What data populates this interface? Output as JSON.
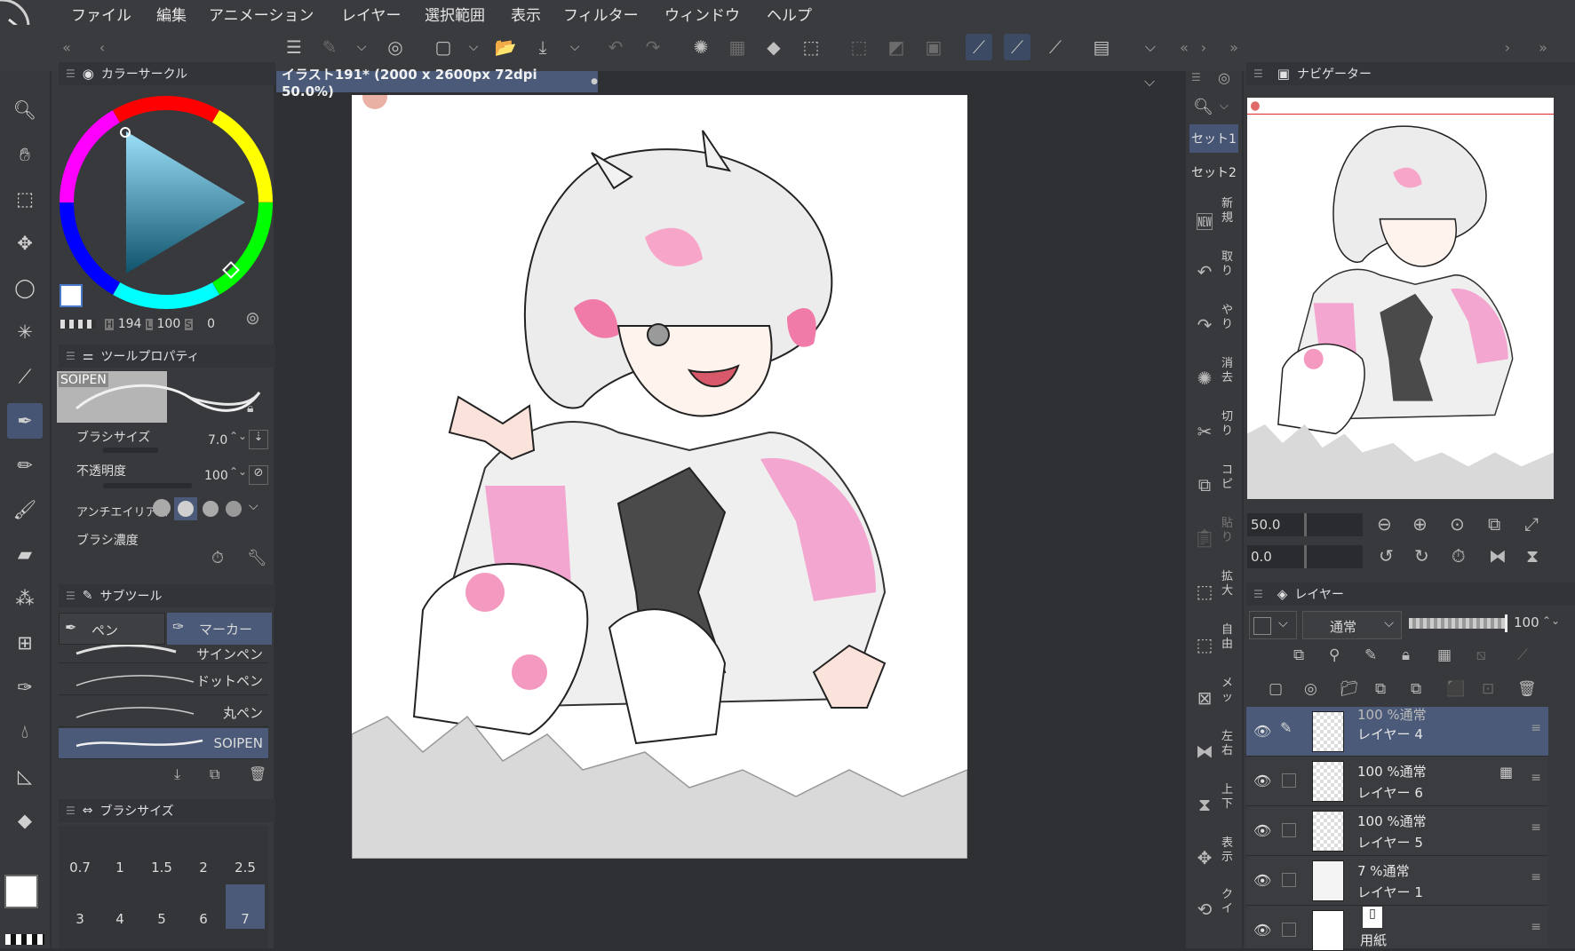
{
  "menu": [
    "ファイル",
    "編集",
    "アニメーション",
    "レイヤー",
    "選択範囲",
    "表示",
    "フィルター",
    "ウィンドウ",
    "ヘルプ"
  ],
  "color_circle": {
    "title": "カラーサークル",
    "h_label": "H",
    "h": "194",
    "l_label": "L",
    "l": "100",
    "s_label": "S",
    "s": "0"
  },
  "tool_property": {
    "title": "ツールプロパティ",
    "brush_name": "SOIPEN",
    "brush_size_label": "ブラシサイズ",
    "brush_size": "7.0",
    "opacity_label": "不透明度",
    "opacity": "100",
    "antialias_label": "アンチエイリアス",
    "density_label": "ブラシ濃度"
  },
  "subtool": {
    "title": "サブツール",
    "tabs": [
      "ペン",
      "マーカー"
    ],
    "active_tab": "マーカー",
    "items": [
      "サインペン",
      "ドットペン",
      "丸ペン",
      "SOIPEN"
    ],
    "selected": "SOIPEN"
  },
  "brush_size_panel": {
    "title": "ブラシサイズ",
    "sizes_row1": [
      "0.7",
      "1",
      "1.5",
      "2",
      "2.5"
    ],
    "sizes_row2": [
      "3",
      "4",
      "5",
      "6",
      "7"
    ],
    "selected": "7"
  },
  "document": {
    "tab_title": "イラスト191* (2000 x 2600px 72dpi 50.0%)"
  },
  "sets": [
    "セット1",
    "セット2"
  ],
  "quick_access": [
    {
      "icon": "new-icon",
      "label": "新規"
    },
    {
      "icon": "undo-icon",
      "label": "取り"
    },
    {
      "icon": "redo-icon",
      "label": "やり"
    },
    {
      "icon": "clear-icon",
      "label": "消去"
    },
    {
      "icon": "cut-icon",
      "label": "切り"
    },
    {
      "icon": "copy-icon",
      "label": "コピ"
    },
    {
      "icon": "paste-icon",
      "label": "貼り"
    },
    {
      "icon": "scale-icon",
      "label": "拡大"
    },
    {
      "icon": "free-transform-icon",
      "label": "自由"
    },
    {
      "icon": "mesh-icon",
      "label": "メッ"
    },
    {
      "icon": "flip-h-icon",
      "label": "左右"
    },
    {
      "icon": "flip-v-icon",
      "label": "上下"
    },
    {
      "icon": "show-icon",
      "label": "表示"
    },
    {
      "icon": "quick-icon",
      "label": "クイ"
    }
  ],
  "navigator": {
    "title": "ナビゲーター",
    "zoom": "50.0",
    "rotate": "0.0"
  },
  "layers_panel": {
    "title": "レイヤー",
    "blend_mode": "通常",
    "opacity": "100",
    "layers": [
      {
        "mode": "100 %通常",
        "name": "レイヤー 4",
        "selected": true
      },
      {
        "mode": "100 %通常",
        "name": "レイヤー 6",
        "selected": false
      },
      {
        "mode": "100 %通常",
        "name": "レイヤー 5",
        "selected": false
      },
      {
        "mode": "7 %通常",
        "name": "レイヤー 1",
        "selected": false
      },
      {
        "mode": "",
        "name": "用紙",
        "selected": false
      }
    ]
  },
  "colors": {
    "accent": "#465573",
    "panel": "#38393c",
    "pink": "#f3a6cf"
  }
}
